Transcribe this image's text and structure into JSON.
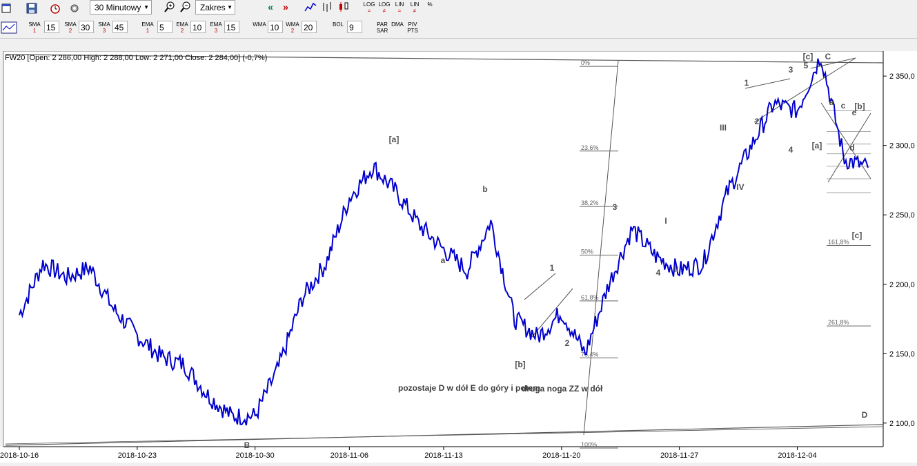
{
  "toolbar": {
    "interval_label": "30 Minutowy",
    "range_label": "Zakres",
    "scale_buttons": [
      {
        "top": "LOG",
        "bottom": "="
      },
      {
        "top": "LOG",
        "bottom": "≠"
      },
      {
        "top": "LIN",
        "bottom": "="
      },
      {
        "top": "LIN",
        "bottom": "≠"
      },
      {
        "top": "%",
        "bottom": ""
      }
    ]
  },
  "indicators": [
    {
      "name": "SMA",
      "num": "1",
      "value": "15"
    },
    {
      "name": "SMA",
      "num": "2",
      "value": "30"
    },
    {
      "name": "SMA",
      "num": "3",
      "value": "45"
    },
    {
      "name": "EMA",
      "num": "1",
      "value": "5"
    },
    {
      "name": "EMA",
      "num": "2",
      "value": "10"
    },
    {
      "name": "EMA",
      "num": "3",
      "value": "15"
    },
    {
      "name": "WMA",
      "num": "",
      "value": "10"
    },
    {
      "name": "WMA",
      "num": "2",
      "value": "20"
    },
    {
      "name": "BOL",
      "num": "",
      "value": "9"
    },
    {
      "name": "PAR SAR",
      "num": "",
      "value": ""
    },
    {
      "name": "DMA",
      "num": "",
      "value": ""
    },
    {
      "name": "PIV PTS",
      "num": "",
      "value": ""
    }
  ],
  "colors": {
    "price": "#0000cc",
    "lines": "#555555",
    "labels": "#505050",
    "fib": "#606060"
  },
  "chart_data": {
    "type": "line",
    "title": "FW20 [Open: 2 286,00  High: 2 288,00  Low: 2 271,00  Close: 2 284,00] (-0,7%)",
    "x": [
      "2018-10-16",
      "2018-10-17",
      "2018-10-18",
      "2018-10-19",
      "2018-10-22",
      "2018-10-23",
      "2018-10-24",
      "2018-10-25",
      "2018-10-26",
      "2018-10-29",
      "2018-10-30",
      "2018-10-31",
      "2018-11-02",
      "2018-11-05",
      "2018-11-06",
      "2018-11-07",
      "2018-11-08",
      "2018-11-09",
      "2018-11-13",
      "2018-11-14",
      "2018-11-15",
      "2018-11-16",
      "2018-11-19",
      "2018-11-20",
      "2018-11-21",
      "2018-11-22",
      "2018-11-23",
      "2018-11-26",
      "2018-11-27",
      "2018-11-28",
      "2018-11-29",
      "2018-11-30",
      "2018-12-03",
      "2018-12-04",
      "2018-12-05",
      "2018-12-06",
      "2018-12-07"
    ],
    "xticks": [
      "2018-10-16",
      "2018-10-23",
      "2018-10-30",
      "2018-11-06",
      "2018-11-13",
      "2018-11-20",
      "2018-11-27",
      "2018-12-04"
    ],
    "series": [
      {
        "values": [
          2178,
          2215,
          2205,
          2212,
          2182,
          2163,
          2148,
          2142,
          2120,
          2105,
          2105,
          2140,
          2190,
          2215,
          2262,
          2285,
          2266,
          2242,
          2225,
          2210,
          2245,
          2175,
          2162,
          2180,
          2150,
          2200,
          2240,
          2220,
          2210,
          2215,
          2265,
          2298,
          2330,
          2325,
          2365,
          2290,
          2284
        ]
      }
    ],
    "yticks": [
      "2 100,0",
      "2 150,0",
      "2 200,0",
      "2 250,0",
      "2 300,0",
      "2 350,0"
    ],
    "ylim": [
      2083,
      2368
    ],
    "current_price_labels": [
      "2 300,0"
    ],
    "fib_levels": [
      {
        "label": "0%",
        "value": 2357
      },
      {
        "label": "23,6%",
        "value": 2296
      },
      {
        "label": "38,2%",
        "value": 2256
      },
      {
        "label": "50%",
        "value": 2221
      },
      {
        "label": "61,8%",
        "value": 2188
      },
      {
        "label": "76,4%",
        "value": 2147
      },
      {
        "label": "100%",
        "value": 2082
      }
    ],
    "fib_levels_right": [
      {
        "label": "161,8%",
        "value": 2228
      },
      {
        "label": "261,8%",
        "value": 2170
      }
    ],
    "wave_labels": [
      "[a]",
      "b",
      "a",
      "[b]",
      "1",
      "2",
      "3",
      "I",
      "II",
      "III",
      "IV",
      "1",
      "2",
      "3",
      "4",
      "5",
      "[c]",
      "C",
      "a",
      "c",
      "[b]",
      "[a]",
      "d",
      "e",
      "[c]",
      "D",
      "B",
      "4"
    ],
    "annotations": [
      "pozostaje D w dół E do góry i potem",
      "druga noga ZZ w dół"
    ]
  }
}
